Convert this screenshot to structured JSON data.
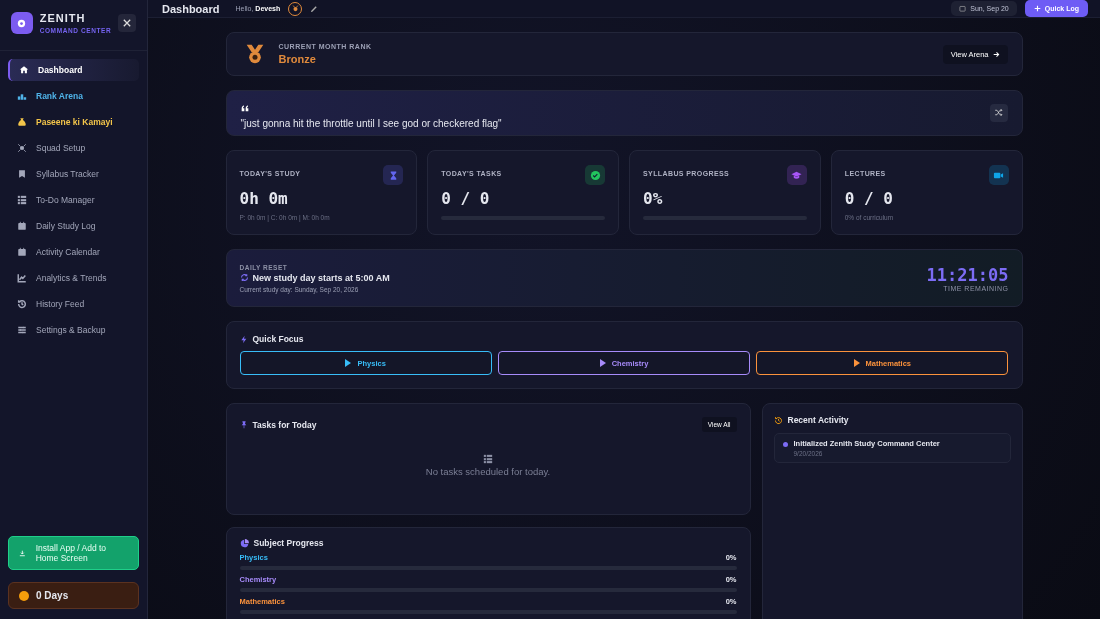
{
  "sidebar": {
    "brand": "ZENITH",
    "subtitle": "COMMAND CENTER",
    "items": [
      {
        "label": "Dashboard",
        "selected": true,
        "color": "#ffffff"
      },
      {
        "label": "Rank Arena",
        "selected": false,
        "color": "#4fb3e8"
      },
      {
        "label": "Paseene ki Kamayi",
        "selected": false,
        "color": "#f3c54a"
      },
      {
        "label": "Squad Setup",
        "selected": false,
        "color": "#a3a7ba"
      },
      {
        "label": "Syllabus Tracker",
        "selected": false,
        "color": "#a3a7ba"
      },
      {
        "label": "To-Do Manager",
        "selected": false,
        "color": "#a3a7ba"
      },
      {
        "label": "Daily Study Log",
        "selected": false,
        "color": "#a3a7ba"
      },
      {
        "label": "Activity Calendar",
        "selected": false,
        "color": "#a3a7ba"
      },
      {
        "label": "Analytics & Trends",
        "selected": false,
        "color": "#a3a7ba"
      },
      {
        "label": "History Feed",
        "selected": false,
        "color": "#a3a7ba"
      },
      {
        "label": "Settings & Backup",
        "selected": false,
        "color": "#a3a7ba"
      }
    ],
    "install_button": "Install App / Add to Home Screen",
    "streak": "0 Days"
  },
  "header": {
    "title": "Dashboard",
    "greeting": "Hello,",
    "user": "Devesh",
    "date": "Sun, Sep 20",
    "quick_log": "Quick Log"
  },
  "rank": {
    "label": "CURRENT MONTH RANK",
    "value": "Bronze",
    "button": "View Arena"
  },
  "quote": {
    "text": "\"just gonna hit the throttle until I see god or checkered flag\""
  },
  "stats": [
    {
      "kind": "sub",
      "label": "TODAY'S STUDY",
      "value": "0h 0m",
      "sub": "P: 0h 0m | C: 0h 0m | M: 0h 0m",
      "color": "#6366f1"
    },
    {
      "kind": "bar",
      "label": "TODAY'S TASKS",
      "value": "0 / 0",
      "level": 0,
      "color": "#22c55e"
    },
    {
      "kind": "bar",
      "label": "SYLLABUS PROGRESS",
      "value": "0%",
      "level": 0,
      "color": "#a855f7"
    },
    {
      "kind": "sub",
      "label": "LECTURES",
      "value": "0 / 0",
      "sub": "0% of curriculum",
      "color": "#0ea5e9"
    }
  ],
  "daily_reset": {
    "label": "DAILY RESET",
    "title": "New study day starts at 5:00 AM",
    "sub": "Current study day: Sunday, Sep 20, 2026",
    "countdown": "11:21:05",
    "countdown_label": "TIME REMAINING"
  },
  "quick_focus": {
    "title": "Quick Focus",
    "subjects": [
      {
        "label": "Physics",
        "color": "#38bdf8"
      },
      {
        "label": "Chemistry",
        "color": "#a78bfa"
      },
      {
        "label": "Mathematics",
        "color": "#fb923c"
      }
    ]
  },
  "tasks": {
    "title": "Tasks for Today",
    "view_all": "View All",
    "empty": "No tasks scheduled for today."
  },
  "recent_activity": {
    "title": "Recent Activity",
    "items": [
      {
        "text": "Initialized Zenith Study Command Center",
        "date": "9/20/2026"
      }
    ]
  },
  "subject_progress": {
    "title": "Subject Progress",
    "rows": [
      {
        "label": "Physics",
        "percent": "0%",
        "level": 0,
        "color": "#38bdf8"
      },
      {
        "label": "Chemistry",
        "percent": "0%",
        "level": 0,
        "color": "#a78bfa"
      },
      {
        "label": "Mathematics",
        "percent": "0%",
        "level": 0,
        "color": "#fb923c"
      }
    ]
  }
}
